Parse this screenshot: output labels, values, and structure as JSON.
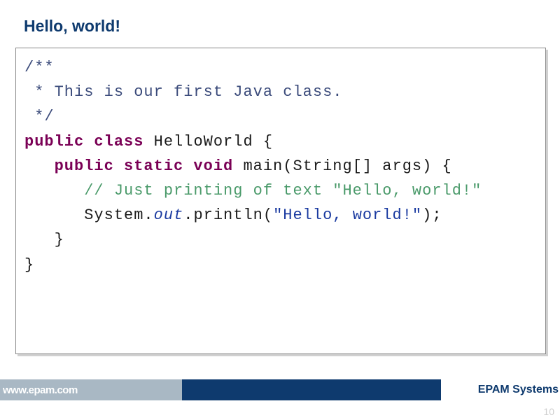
{
  "title": "Hello, world!",
  "code": {
    "l1": "/**",
    "l2": " * This is our first Java class.",
    "l3": " */",
    "l4a": "public class ",
    "l4b": "HelloWorld {",
    "l5": "",
    "l6a": "   public static void ",
    "l6b": "main(String[] args) {",
    "l7": "      // Just printing of text \"Hello, world!\"",
    "l8a": "      System.",
    "l8b": "out",
    "l8c": ".println(",
    "l8d": "\"Hello, world!\"",
    "l8e": ");",
    "l9": "   }",
    "l10": "}"
  },
  "footer": {
    "url": "www.epam.com",
    "brand": "EPAM Systems"
  },
  "page_number": "10"
}
